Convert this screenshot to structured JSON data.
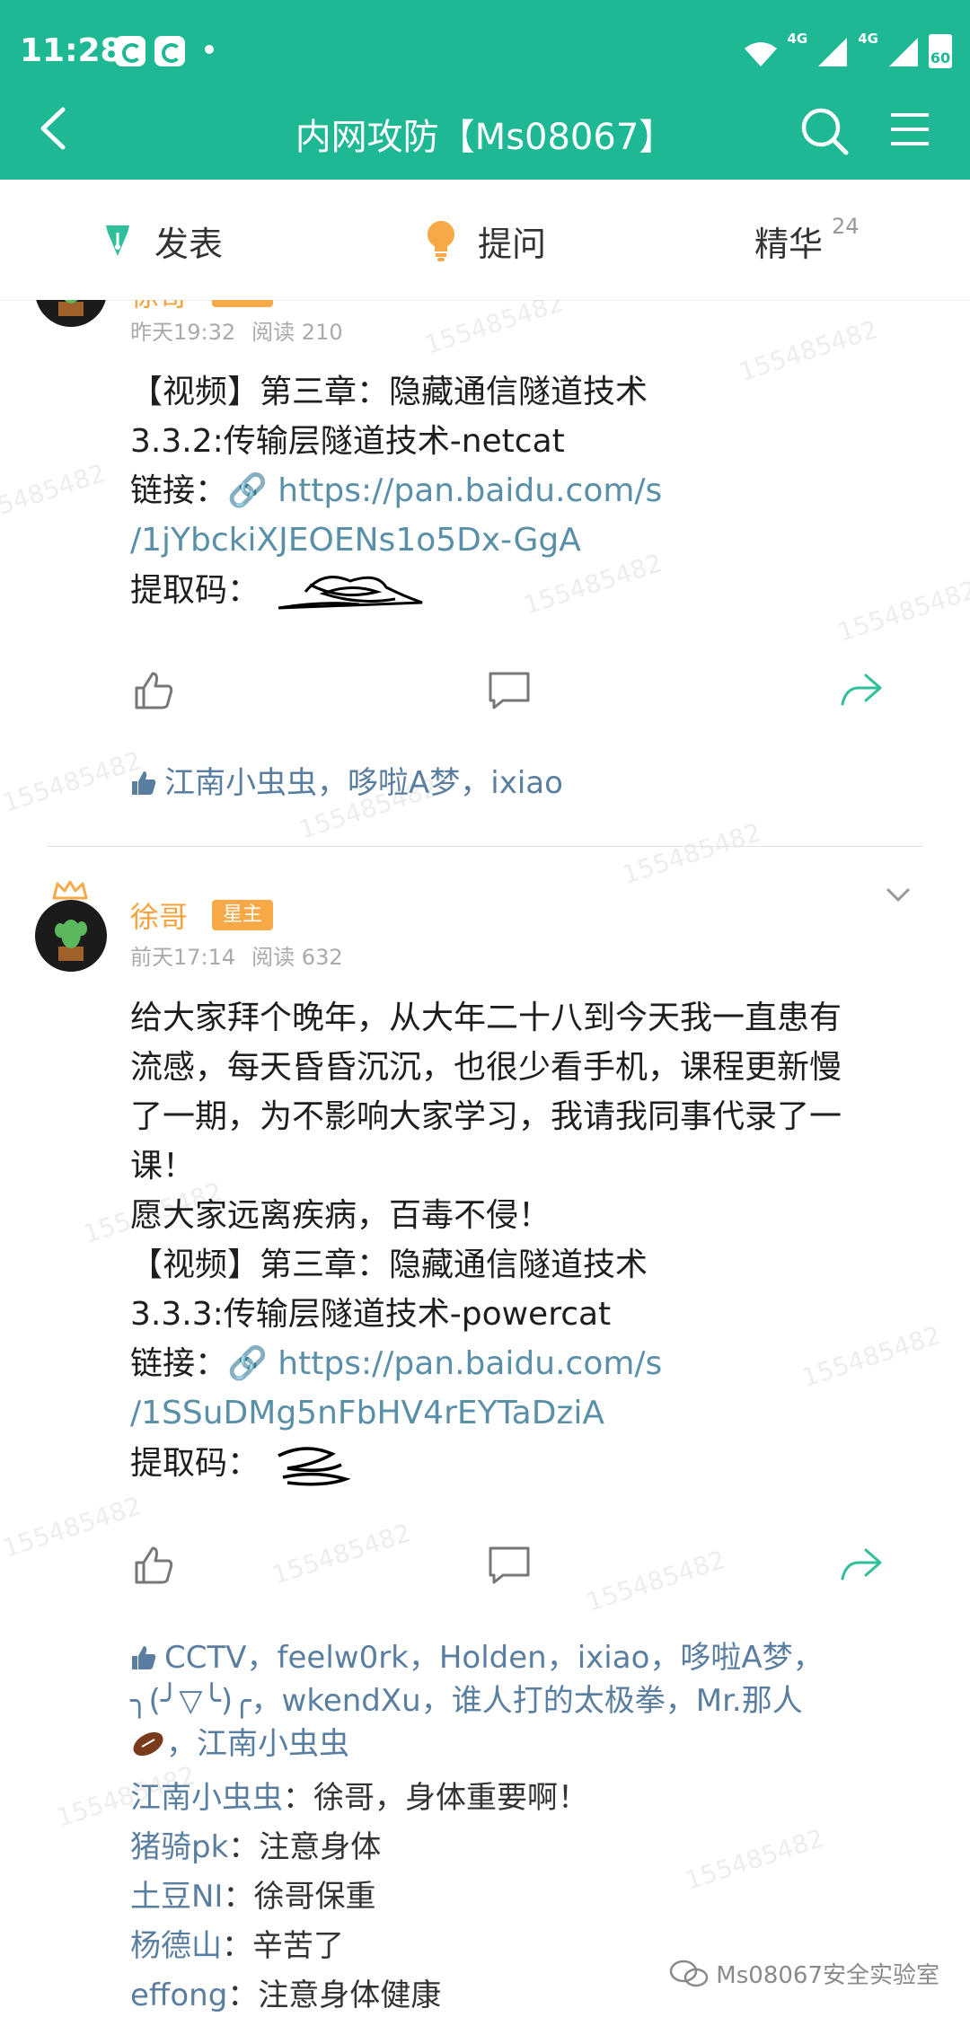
{
  "status_bar": {
    "time": "11:28",
    "net1": "4G",
    "net2": "4G",
    "battery": "60"
  },
  "header": {
    "title": "内网攻防【Ms08067】"
  },
  "tabs": [
    {
      "label": "发表",
      "icon": "pen-icon"
    },
    {
      "label": "提问",
      "icon": "lightbulb-icon"
    },
    {
      "label": "精华",
      "count": "24"
    }
  ],
  "posts": [
    {
      "author": "徐哥",
      "badge": "星主",
      "time": "昨天19:32",
      "reads": "阅读 210",
      "lines": [
        "【视频】第三章：隐藏通信隧道技术",
        "3.3.2:传输层隧道技术-netcat"
      ],
      "link_label": "链接：",
      "link_lines": [
        "https://pan.baidu.com/s",
        "/1jYbckiXJEOENs1o5Dx-GgA"
      ],
      "code_label": "提取码：",
      "likes": "江南小虫虫，哆啦A梦，ixiao"
    },
    {
      "author": "徐哥",
      "badge": "星主",
      "time": "前天17:14",
      "reads": "阅读 632",
      "lines": [
        "给大家拜个晚年，从大年二十八到今天我一直患有",
        "流感，每天昏昏沉沉，也很少看手机，课程更新慢",
        "了一期，为不影响大家学习，我请我同事代录了一",
        "课！",
        "愿大家远离疾病，百毒不侵！",
        "【视频】第三章：隐藏通信隧道技术",
        "3.3.3:传输层隧道技术-powercat"
      ],
      "link_label": "链接：",
      "link_lines": [
        "https://pan.baidu.com/s",
        "/1SSuDMg5nFbHV4rEYTaDziA"
      ],
      "code_label": "提取码：",
      "likes_lines": [
        "CCTV，feelw0rk，Holden，ixiao，哆啦A梦，",
        "╮(╯▽╰)╭，wkendXu，谁人打的太极拳，Mr.那人",
        "，江南小虫虫"
      ],
      "comments": [
        {
          "name": "江南小虫虫",
          "text": "：徐哥，身体重要啊！"
        },
        {
          "name": "猪骑pk",
          "text": "：注意身体"
        },
        {
          "name": "土豆NI",
          "text": "：徐哥保重"
        },
        {
          "name": "杨德山",
          "text": "：辛苦了"
        },
        {
          "name": "effong",
          "text": "：注意身体健康"
        }
      ]
    }
  ],
  "watermark": "155485482",
  "footer_brand": "Ms08067安全实验室"
}
